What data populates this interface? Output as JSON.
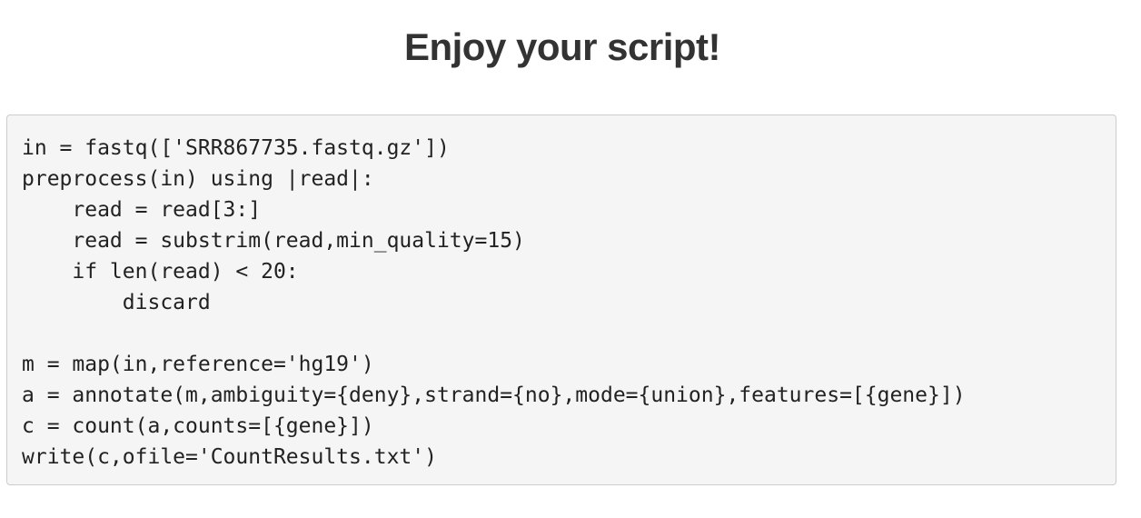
{
  "page": {
    "title": "Enjoy your script!"
  },
  "script": {
    "lines": [
      "in = fastq(['SRR867735.fastq.gz'])",
      "preprocess(in) using |read|:",
      "    read = read[3:]",
      "    read = substrim(read,min_quality=15)",
      "    if len(read) < 20:",
      "        discard",
      "",
      "m = map(in,reference='hg19')",
      "a = annotate(m,ambiguity={deny},strand={no},mode={union},features=[{gene}])",
      "c = count(a,counts=[{gene}])",
      "write(c,ofile='CountResults.txt')"
    ]
  }
}
